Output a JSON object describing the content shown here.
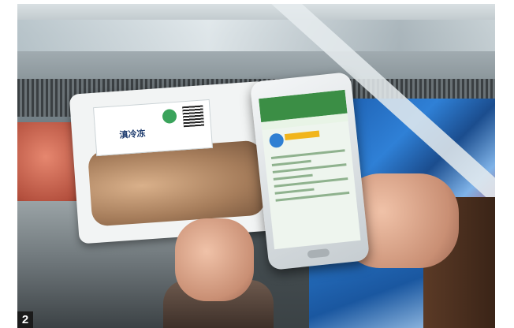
{
  "photo": {
    "figure_number": "2",
    "label_text": "滇冷冻"
  }
}
